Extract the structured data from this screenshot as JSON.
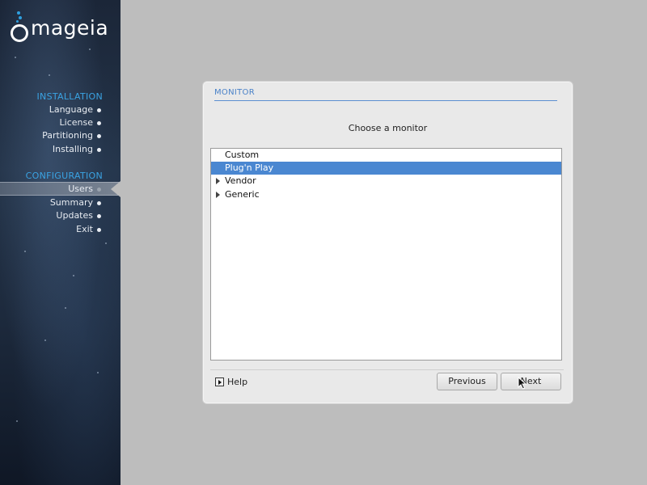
{
  "brand": {
    "name": "mageia"
  },
  "sidebar": {
    "sections": [
      {
        "title": "INSTALLATION",
        "items": [
          {
            "label": "Language",
            "active": false
          },
          {
            "label": "License",
            "active": false
          },
          {
            "label": "Partitioning",
            "active": false
          },
          {
            "label": "Installing",
            "active": false
          }
        ]
      },
      {
        "title": "CONFIGURATION",
        "items": [
          {
            "label": "Users",
            "active": true
          },
          {
            "label": "Summary",
            "active": false
          },
          {
            "label": "Updates",
            "active": false
          },
          {
            "label": "Exit",
            "active": false
          }
        ]
      }
    ]
  },
  "dialog": {
    "title": "MONITOR",
    "prompt": "Choose a monitor",
    "list": [
      {
        "label": "Custom",
        "expandable": false,
        "selected": false
      },
      {
        "label": "Plug'n Play",
        "expandable": false,
        "selected": true
      },
      {
        "label": "Vendor",
        "expandable": true,
        "selected": false
      },
      {
        "label": "Generic",
        "expandable": true,
        "selected": false
      }
    ],
    "help_label": "Help",
    "previous_label": "Previous",
    "next_label": "Next"
  },
  "colors": {
    "accent": "#3aa3e3",
    "selection": "#4a87d1",
    "title": "#4a82c8"
  }
}
